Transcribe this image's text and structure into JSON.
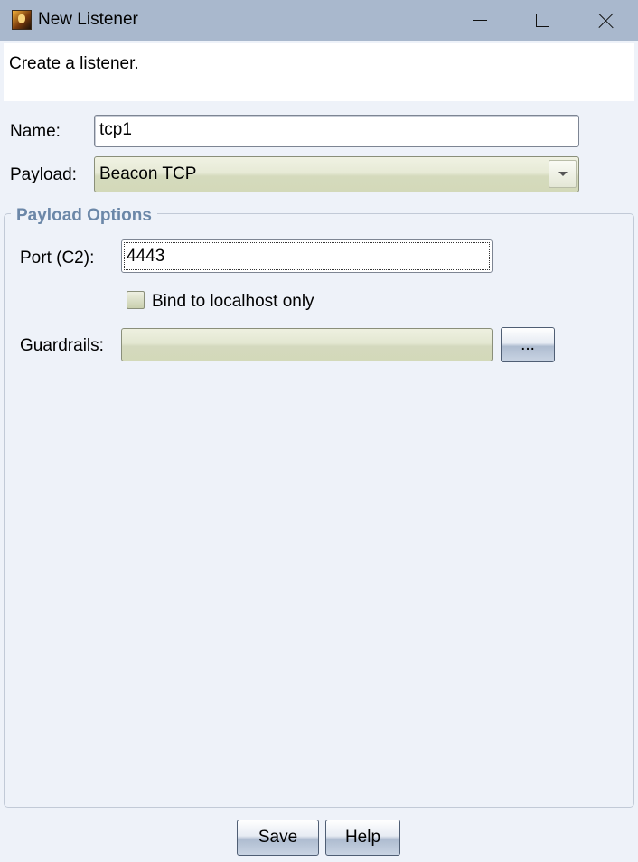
{
  "window": {
    "title": "New Listener",
    "icon": "cobalt-strike-app-icon"
  },
  "description": "Create a listener.",
  "form": {
    "name_label": "Name:",
    "name_value": "tcp1",
    "payload_label": "Payload:",
    "payload_value": "Beacon TCP"
  },
  "payload_options": {
    "title": "Payload Options",
    "port_label": "Port (C2):",
    "port_value": "4443",
    "bind_label": "Bind to localhost only",
    "bind_checked": false,
    "guardrails_label": "Guardrails:",
    "guardrails_value": "",
    "browse_label": "..."
  },
  "buttons": {
    "save": "Save",
    "help": "Help"
  },
  "colors": {
    "titlebar": "#a9b8cd",
    "background": "#eef2f9",
    "group_title": "#6b87a8"
  }
}
